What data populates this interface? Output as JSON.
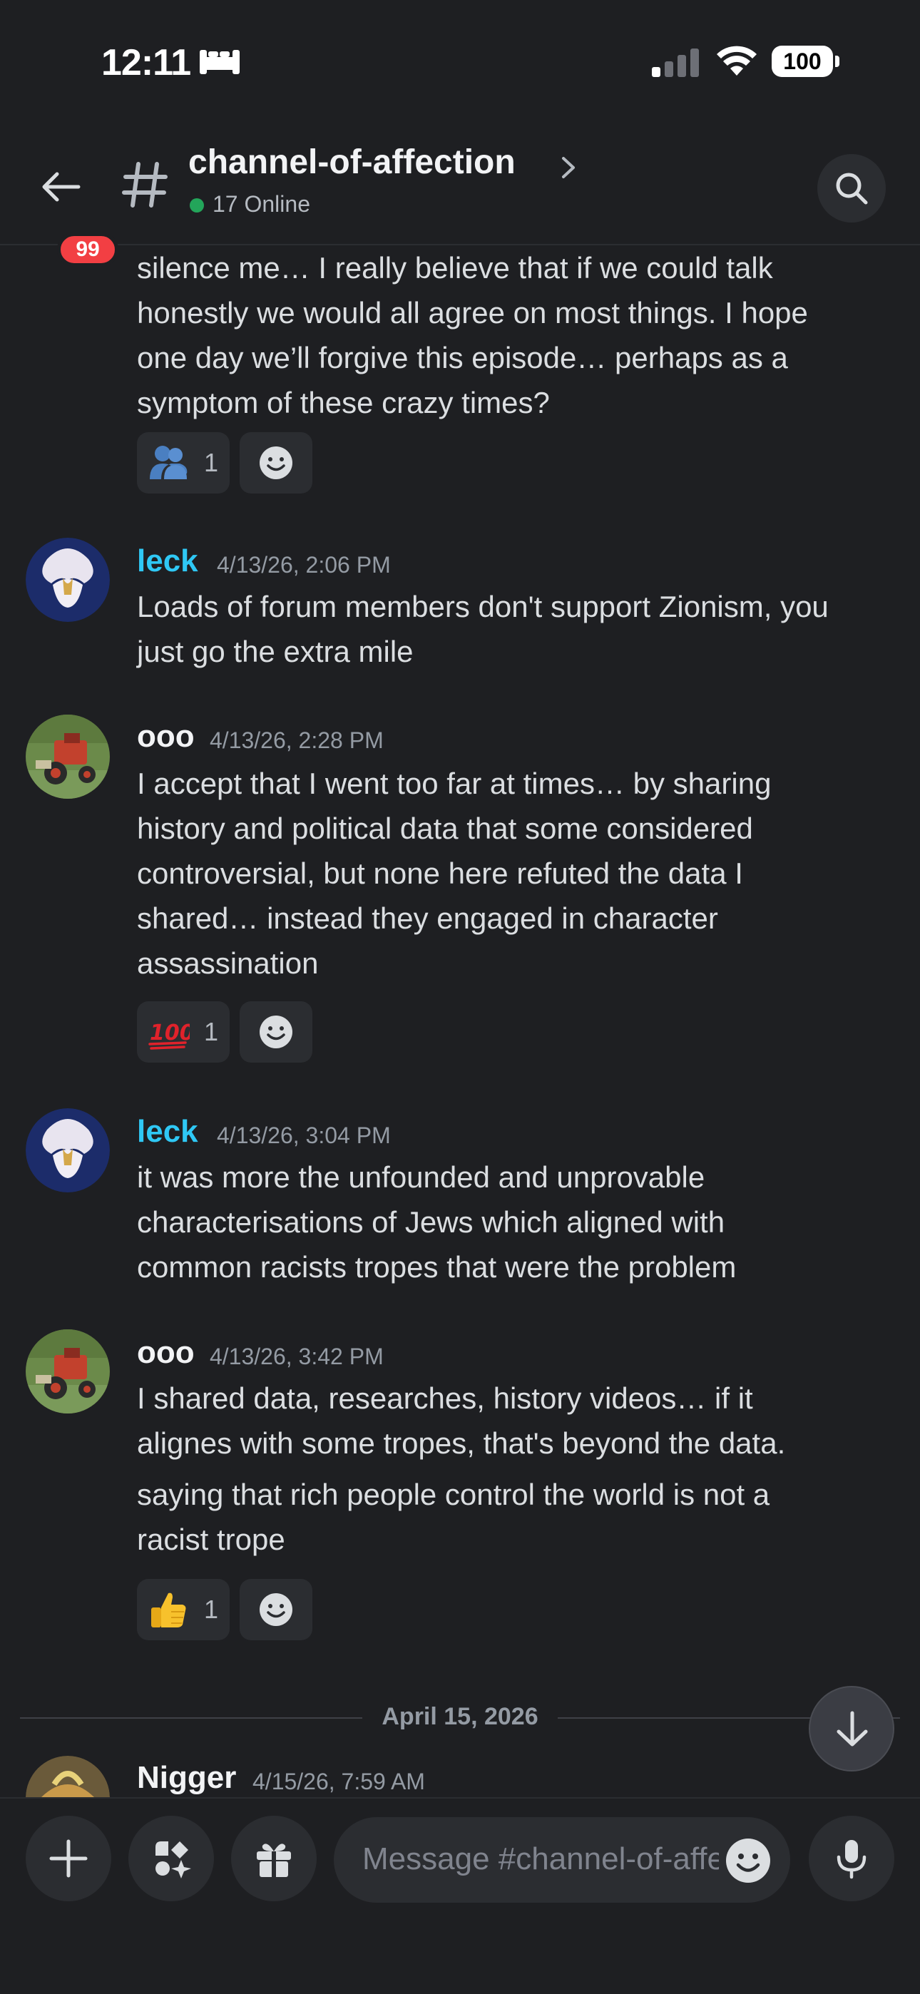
{
  "status_bar": {
    "time": "12:11",
    "battery": "100"
  },
  "header": {
    "badge": "99",
    "channel_name": "channel-of-affection",
    "online": "17 Online"
  },
  "messages": {
    "partial_lines": [
      "silence me…  I really believe that if we could talk",
      "honestly we would all agree on most things. I hope",
      "one day we’ll forgive this episode… perhaps as a",
      "symptom of these crazy times?"
    ],
    "partial_reaction": {
      "emoji": "people-hugging-emoji",
      "count": "1"
    },
    "m1": {
      "author": "leck",
      "time": "4/13/26, 2:06 PM",
      "lines": [
        "Loads of forum members don't support Zionism, you",
        "just go the extra mile"
      ]
    },
    "m2": {
      "author": "ooo",
      "time": "4/13/26, 2:28 PM",
      "lines": [
        "I accept that I went too far at times… by sharing",
        "history and political data that some considered",
        "controversial, but none here refuted the data I",
        "shared… instead they engaged in character",
        "assassination"
      ],
      "reaction": {
        "emoji": "hundred-points-emoji",
        "count": "1"
      }
    },
    "m3": {
      "author": "leck",
      "time": "4/13/26, 3:04 PM",
      "lines": [
        "it was more the unfounded and unprovable",
        "characterisations of Jews which aligned with",
        "common racists tropes that were the problem"
      ]
    },
    "m4": {
      "author": "ooo",
      "time": "4/13/26, 3:42 PM",
      "lines": [
        "I shared data, researches, history videos… if it",
        "alignes with some tropes, that's beyond the data."
      ],
      "lines2": [
        "saying that rich people control the world is not a",
        "racist trope"
      ],
      "reaction": {
        "emoji": "thumbs-up-emoji",
        "count": "1"
      }
    },
    "date_divider": "April 15, 2026",
    "m5": {
      "author": "Nigger",
      "time": "4/15/26, 7:59 AM"
    }
  },
  "composer": {
    "placeholder": "Message #channel-of-affection"
  },
  "colors": {
    "background": "#1e1f22",
    "leck_name": "#2fc8f5",
    "badge": "#f23f43",
    "online": "#23a55a"
  }
}
